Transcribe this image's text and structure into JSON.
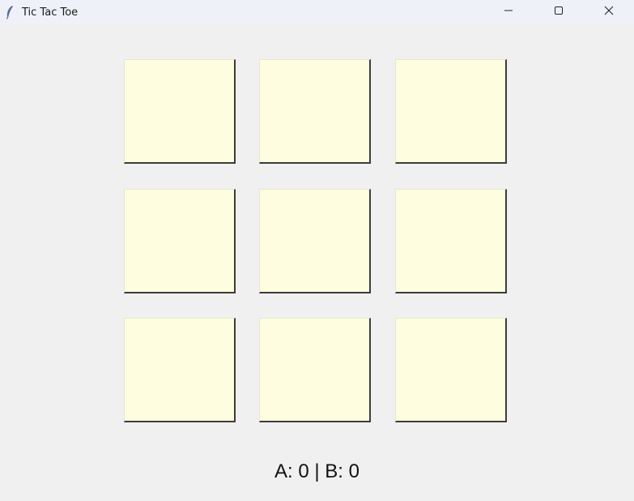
{
  "window": {
    "title": "Tic Tac Toe",
    "icon": "feather-icon",
    "controls": [
      "minimize-icon",
      "maximize-icon",
      "close-icon"
    ]
  },
  "board": {
    "cell_color": "#fffde0",
    "cells": [
      {
        "row": 1,
        "col": 1,
        "mark": ""
      },
      {
        "row": 1,
        "col": 2,
        "mark": ""
      },
      {
        "row": 1,
        "col": 3,
        "mark": ""
      },
      {
        "row": 2,
        "col": 1,
        "mark": ""
      },
      {
        "row": 2,
        "col": 2,
        "mark": ""
      },
      {
        "row": 2,
        "col": 3,
        "mark": ""
      },
      {
        "row": 3,
        "col": 1,
        "mark": ""
      },
      {
        "row": 3,
        "col": 2,
        "mark": ""
      },
      {
        "row": 3,
        "col": 3,
        "mark": ""
      }
    ]
  },
  "score": {
    "text": "A: 0 | B: 0"
  }
}
